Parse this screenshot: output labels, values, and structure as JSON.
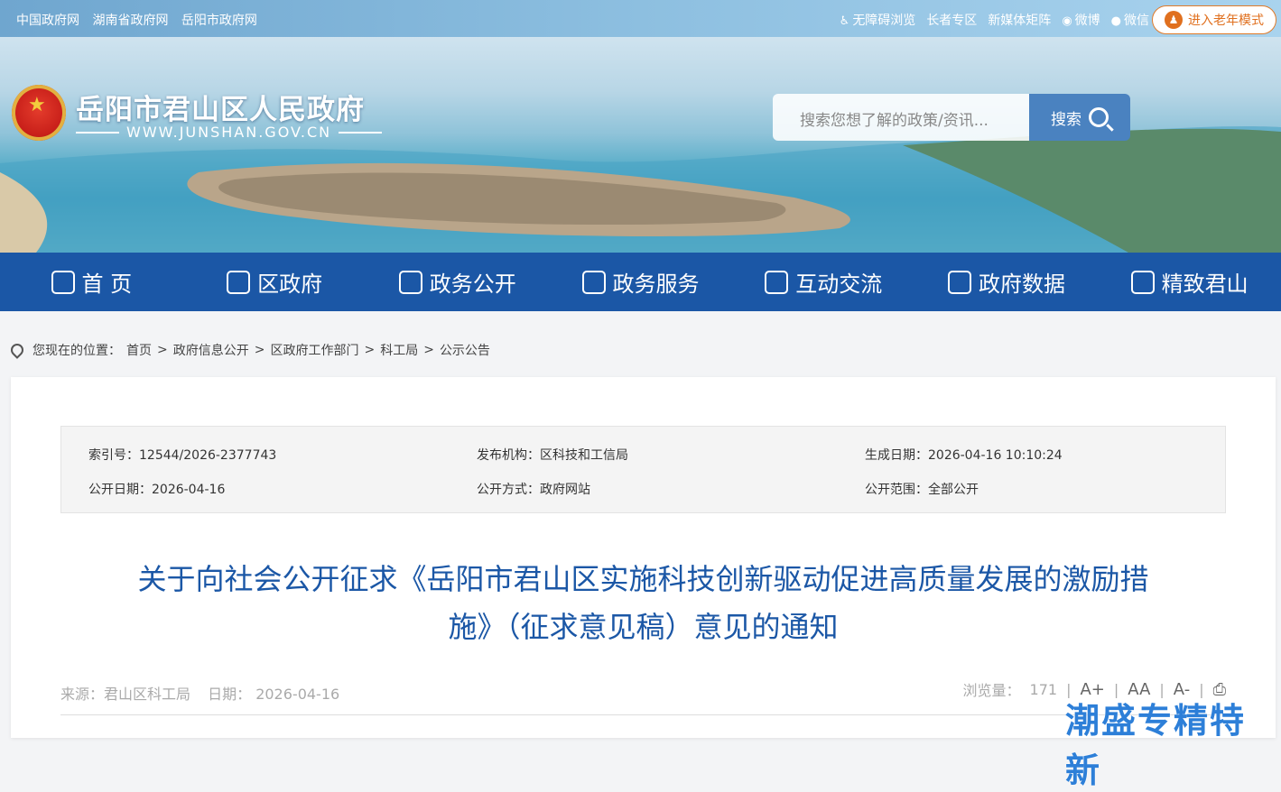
{
  "top_links": [
    "中国政府网",
    "湖南省政府网",
    "岳阳市政府网"
  ],
  "top_right": {
    "accessible": "无障碍浏览",
    "elder_zone": "长者专区",
    "new_media": "新媒体矩阵",
    "weibo": "微博",
    "wechat": "微信",
    "elder_mode": "进入老年模式"
  },
  "site": {
    "title": "岳阳市君山区人民政府",
    "url": "WWW.JUNSHAN.GOV.CN"
  },
  "search": {
    "placeholder": "搜索您想了解的政策/资讯...",
    "button": "搜索"
  },
  "nav": [
    "首 页",
    "区政府",
    "政务公开",
    "政务服务",
    "互动交流",
    "政府数据",
    "精致君山"
  ],
  "breadcrumb": {
    "prefix": "您现在的位置：",
    "items": [
      "首页",
      "政府信息公开",
      "区政府工作部门",
      "科工局",
      "公示公告"
    ],
    "sep": ">"
  },
  "meta": {
    "index_label": "索引号：",
    "index_value": "12544/2026-2377743",
    "publisher_label": "发布机构：",
    "publisher_value": "区科技和工信局",
    "created_label": "生成日期：",
    "created_value": "2026-04-16 10:10:24",
    "public_date_label": "公开日期：",
    "public_date_value": "2026-04-16",
    "method_label": "公开方式：",
    "method_value": "政府网站",
    "scope_label": "公开范围：",
    "scope_value": "全部公开"
  },
  "article": {
    "title_line1": "关于向社会公开征求《岳阳市君山区实施科技创新驱动促进高质量发展的激励措",
    "title_line2": "施》（征求意见稿）意见的通知",
    "source": "来源：君山区科工局",
    "date": "日期：  2026-04-16",
    "views_label": "浏览量：",
    "views": "171",
    "font_larger": "A+",
    "font_normal": "AA",
    "font_smaller": "A-"
  },
  "watermark": "潮盛专精特新"
}
